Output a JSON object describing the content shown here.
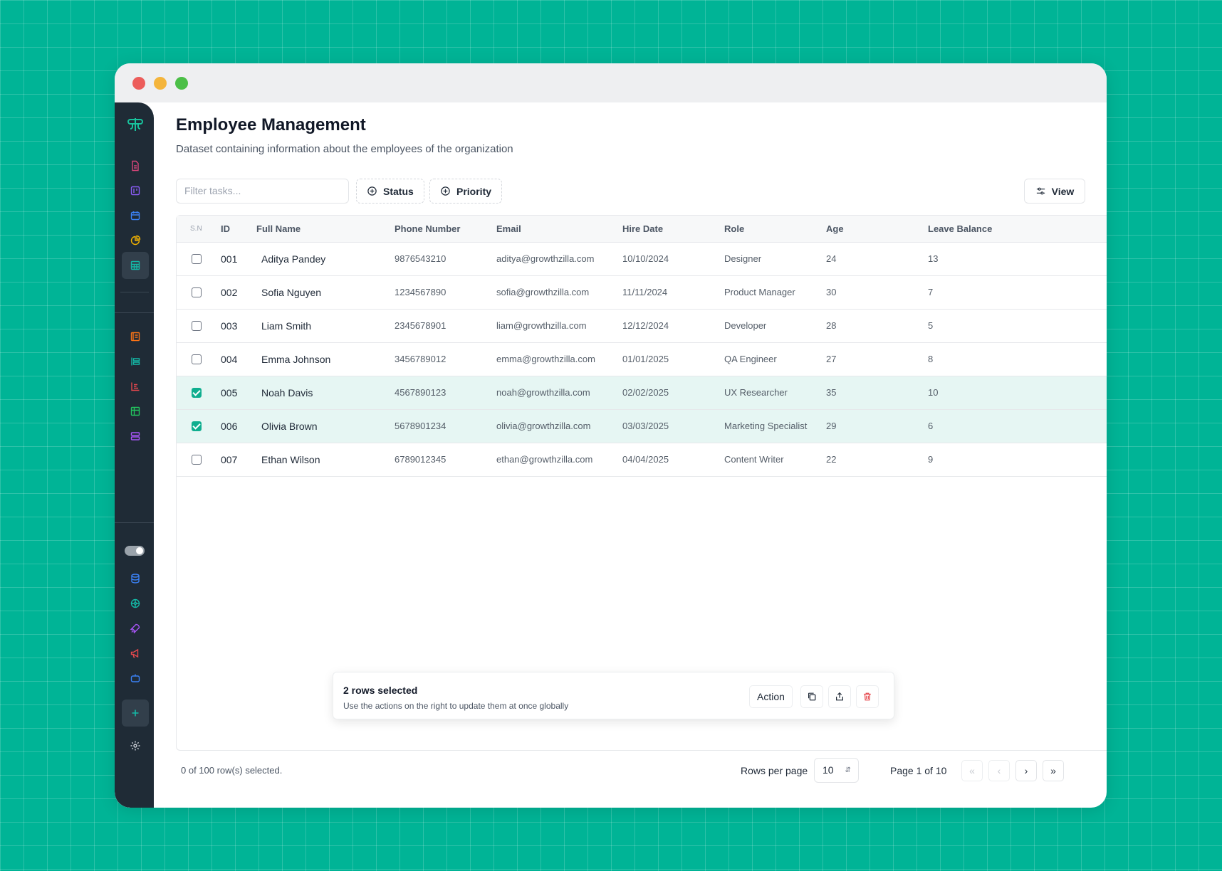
{
  "page": {
    "title": "Employee Management",
    "subtitle": "Dataset containing information about the employees of the organization"
  },
  "toolbar": {
    "filter_placeholder": "Filter tasks...",
    "status_label": "Status",
    "priority_label": "Priority",
    "view_label": "View"
  },
  "table": {
    "headers": {
      "sn": "S.N",
      "id": "ID",
      "full_name": "Full Name",
      "phone": "Phone Number",
      "email": "Email",
      "hire_date": "Hire Date",
      "role": "Role",
      "age": "Age",
      "leave": "Leave Balance"
    },
    "rows": [
      {
        "selected": false,
        "id": "001",
        "name": "Aditya Pandey",
        "phone": "9876543210",
        "email": "aditya@growthzilla.com",
        "hire_date": "10/10/2024",
        "role": "Designer",
        "age": "24",
        "leave": "13"
      },
      {
        "selected": false,
        "id": "002",
        "name": "Sofia Nguyen",
        "phone": "1234567890",
        "email": "sofia@growthzilla.com",
        "hire_date": "11/11/2024",
        "role": "Product Manager",
        "age": "30",
        "leave": "7"
      },
      {
        "selected": false,
        "id": "003",
        "name": "Liam Smith",
        "phone": "2345678901",
        "email": "liam@growthzilla.com",
        "hire_date": "12/12/2024",
        "role": "Developer",
        "age": "28",
        "leave": "5"
      },
      {
        "selected": false,
        "id": "004",
        "name": "Emma Johnson",
        "phone": "3456789012",
        "email": "emma@growthzilla.com",
        "hire_date": "01/01/2025",
        "role": "QA Engineer",
        "age": "27",
        "leave": "8"
      },
      {
        "selected": true,
        "id": "005",
        "name": "Noah Davis",
        "phone": "4567890123",
        "email": "noah@growthzilla.com",
        "hire_date": "02/02/2025",
        "role": "UX Researcher",
        "age": "35",
        "leave": "10"
      },
      {
        "selected": true,
        "id": "006",
        "name": "Olivia Brown",
        "phone": "5678901234",
        "email": "olivia@growthzilla.com",
        "hire_date": "03/03/2025",
        "role": "Marketing Specialist",
        "age": "29",
        "leave": "6"
      },
      {
        "selected": false,
        "id": "007",
        "name": "Ethan Wilson",
        "phone": "6789012345",
        "email": "ethan@growthzilla.com",
        "hire_date": "04/04/2025",
        "role": "Content Writer",
        "age": "22",
        "leave": "9"
      }
    ]
  },
  "selection_bar": {
    "title": "2 rows selected",
    "description": "Use the actions on the right to update them at once globally",
    "action_label": "Action"
  },
  "footer": {
    "selected_text": "0 of 100 row(s) selected.",
    "rows_per_page_label": "Rows per page",
    "rows_per_page_value": "10",
    "page_label": "Page 1 of 10"
  },
  "colors": {
    "background": "#00b496",
    "sidebar": "#1f2b36",
    "accent": "#0fae8f",
    "selected_row": "#e6f6f3",
    "danger": "#e5484d"
  },
  "icons": {
    "sidebar": [
      "logo-icon",
      "document-icon",
      "board-icon",
      "calendar-icon",
      "pie-chart-icon",
      "table-icon",
      "list-icon",
      "list-alt-icon",
      "chart-icon",
      "grid-icon",
      "stack-icon",
      "theme-toggle",
      "database-icon",
      "network-icon",
      "rocket-icon",
      "megaphone-icon",
      "bot-icon",
      "plus-icon",
      "settings-icon"
    ]
  }
}
